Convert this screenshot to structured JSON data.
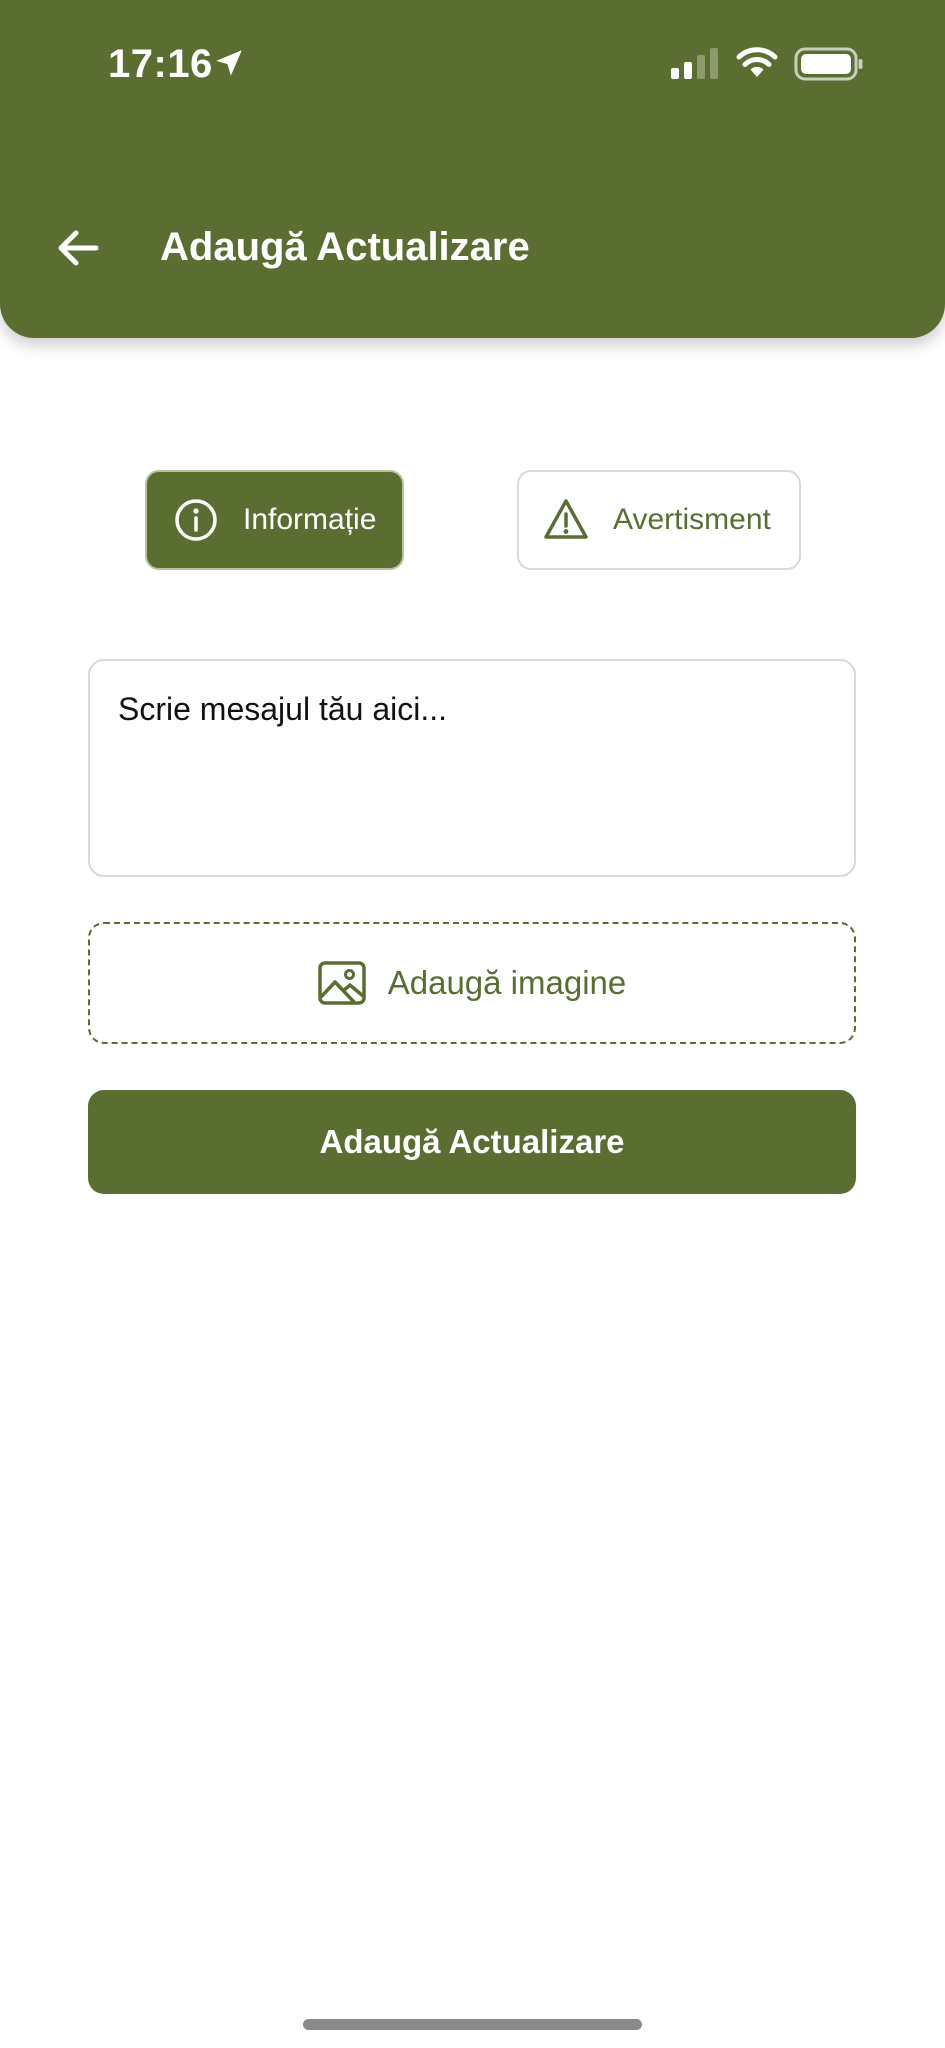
{
  "status_bar": {
    "time": "17:16",
    "icons": [
      "location-arrow-icon",
      "cellular-signal-icon",
      "wifi-icon",
      "battery-icon"
    ]
  },
  "header": {
    "title": "Adaugă Actualizare",
    "back_icon": "arrow-left-icon"
  },
  "update_types": {
    "info": {
      "label": "Informație",
      "icon": "info-circle-icon",
      "selected": true
    },
    "warning": {
      "label": "Avertisment",
      "icon": "warning-triangle-icon",
      "selected": false
    }
  },
  "message": {
    "placeholder": "Scrie mesajul tău aici...",
    "value": ""
  },
  "add_image": {
    "label": "Adaugă imagine",
    "icon": "image-icon"
  },
  "submit": {
    "label": "Adaugă Actualizare"
  },
  "colors": {
    "brand": "#5a6e32",
    "background": "#ffffff",
    "border": "#d9d9d9"
  }
}
